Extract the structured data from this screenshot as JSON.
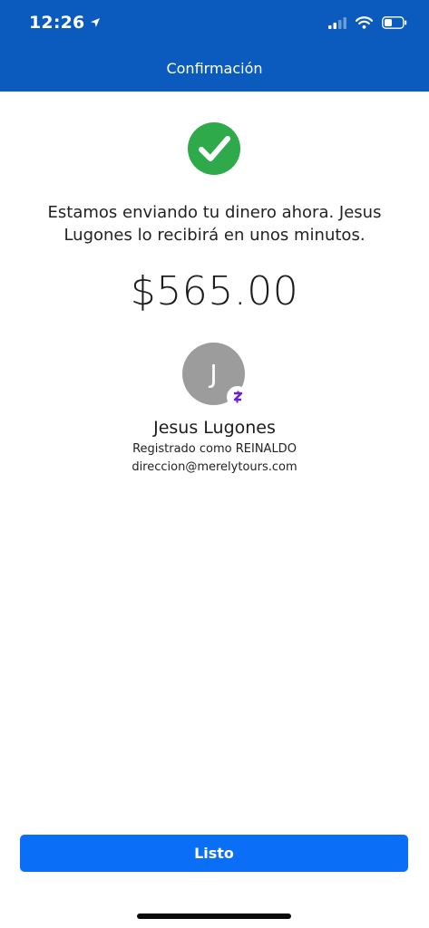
{
  "status_bar": {
    "time": "12:26"
  },
  "header": {
    "title": "Confirmación"
  },
  "confirmation": {
    "message": "Estamos enviando tu dinero ahora. Jesus\nLugones  lo recibirá en unos minutos.",
    "amount": "$565.00"
  },
  "recipient": {
    "avatar_initial": "J",
    "name": "Jesus Lugones",
    "registered_as": "Registrado como REINALDO",
    "email": "direccion@merelytours.com"
  },
  "actions": {
    "done_label": "Listo"
  },
  "colors": {
    "header_bg": "#0a5bbd",
    "success_green": "#2eaa4a",
    "button_blue": "#0a6ef7",
    "zelle_purple": "#6d1ed4",
    "avatar_gray": "#9c9c9c"
  },
  "icons": [
    "location-arrow-icon",
    "cellular-signal-icon",
    "wifi-icon",
    "battery-icon",
    "checkmark-icon",
    "zelle-icon"
  ]
}
